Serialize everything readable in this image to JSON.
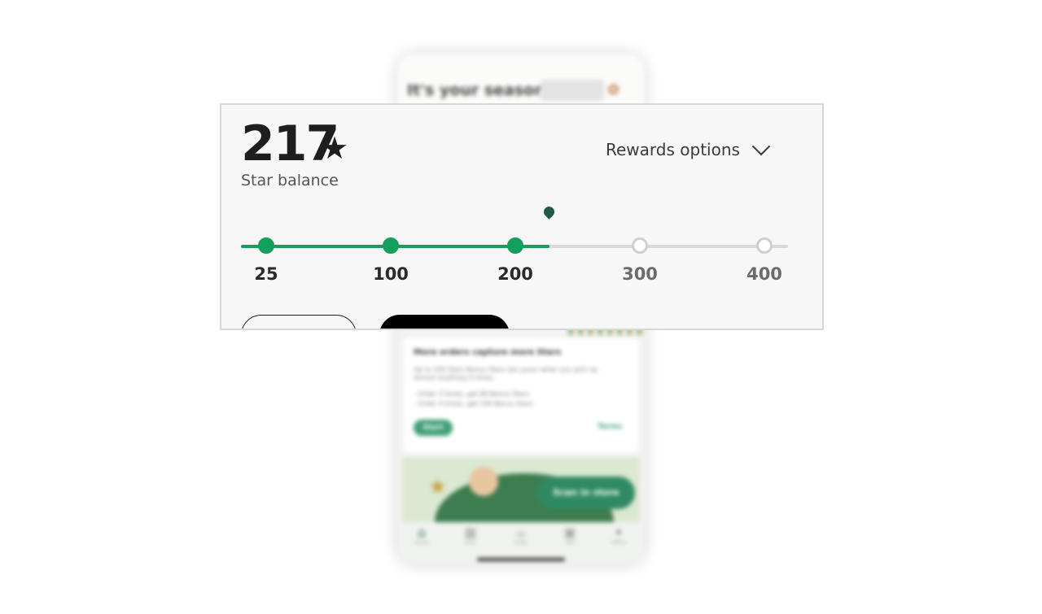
{
  "background_phone": {
    "greeting": "It's your season,",
    "offer": {
      "title": "More orders capture more Stars",
      "lines": [
        "Up to 100 Stars Bonus Stars are yours when you pick up",
        "almost anything 4 times.",
        "- Order 3 times, get 80 Bonus Stars",
        "- Order 4 times, get 100 Bonus Stars"
      ],
      "start_label": "Start",
      "terms_label": "Terms"
    },
    "scan_label": "Scan in store",
    "nav": [
      {
        "label": "Home",
        "icon": "home-icon",
        "active": true
      },
      {
        "label": "Scan",
        "icon": "scan-icon",
        "active": false
      },
      {
        "label": "Order",
        "icon": "cup-icon",
        "active": false
      },
      {
        "label": "Gift",
        "icon": "gift-icon",
        "active": false
      },
      {
        "label": "Offers",
        "icon": "offers-icon",
        "active": false
      }
    ]
  },
  "rewards": {
    "balance": "217",
    "balance_label": "Star balance",
    "options_label": "Rewards options",
    "current_stars": 217,
    "milestones": [
      {
        "label": "25",
        "value": 25,
        "reached": true
      },
      {
        "label": "100",
        "value": 100,
        "reached": true
      },
      {
        "label": "200",
        "value": 200,
        "reached": true
      },
      {
        "label": "300",
        "value": 300,
        "reached": false
      },
      {
        "label": "400",
        "value": 400,
        "reached": false
      }
    ]
  },
  "colors": {
    "accent_green": "#12a05c",
    "marker_green": "#1f5c43",
    "track_gray": "#d9d9d9"
  }
}
